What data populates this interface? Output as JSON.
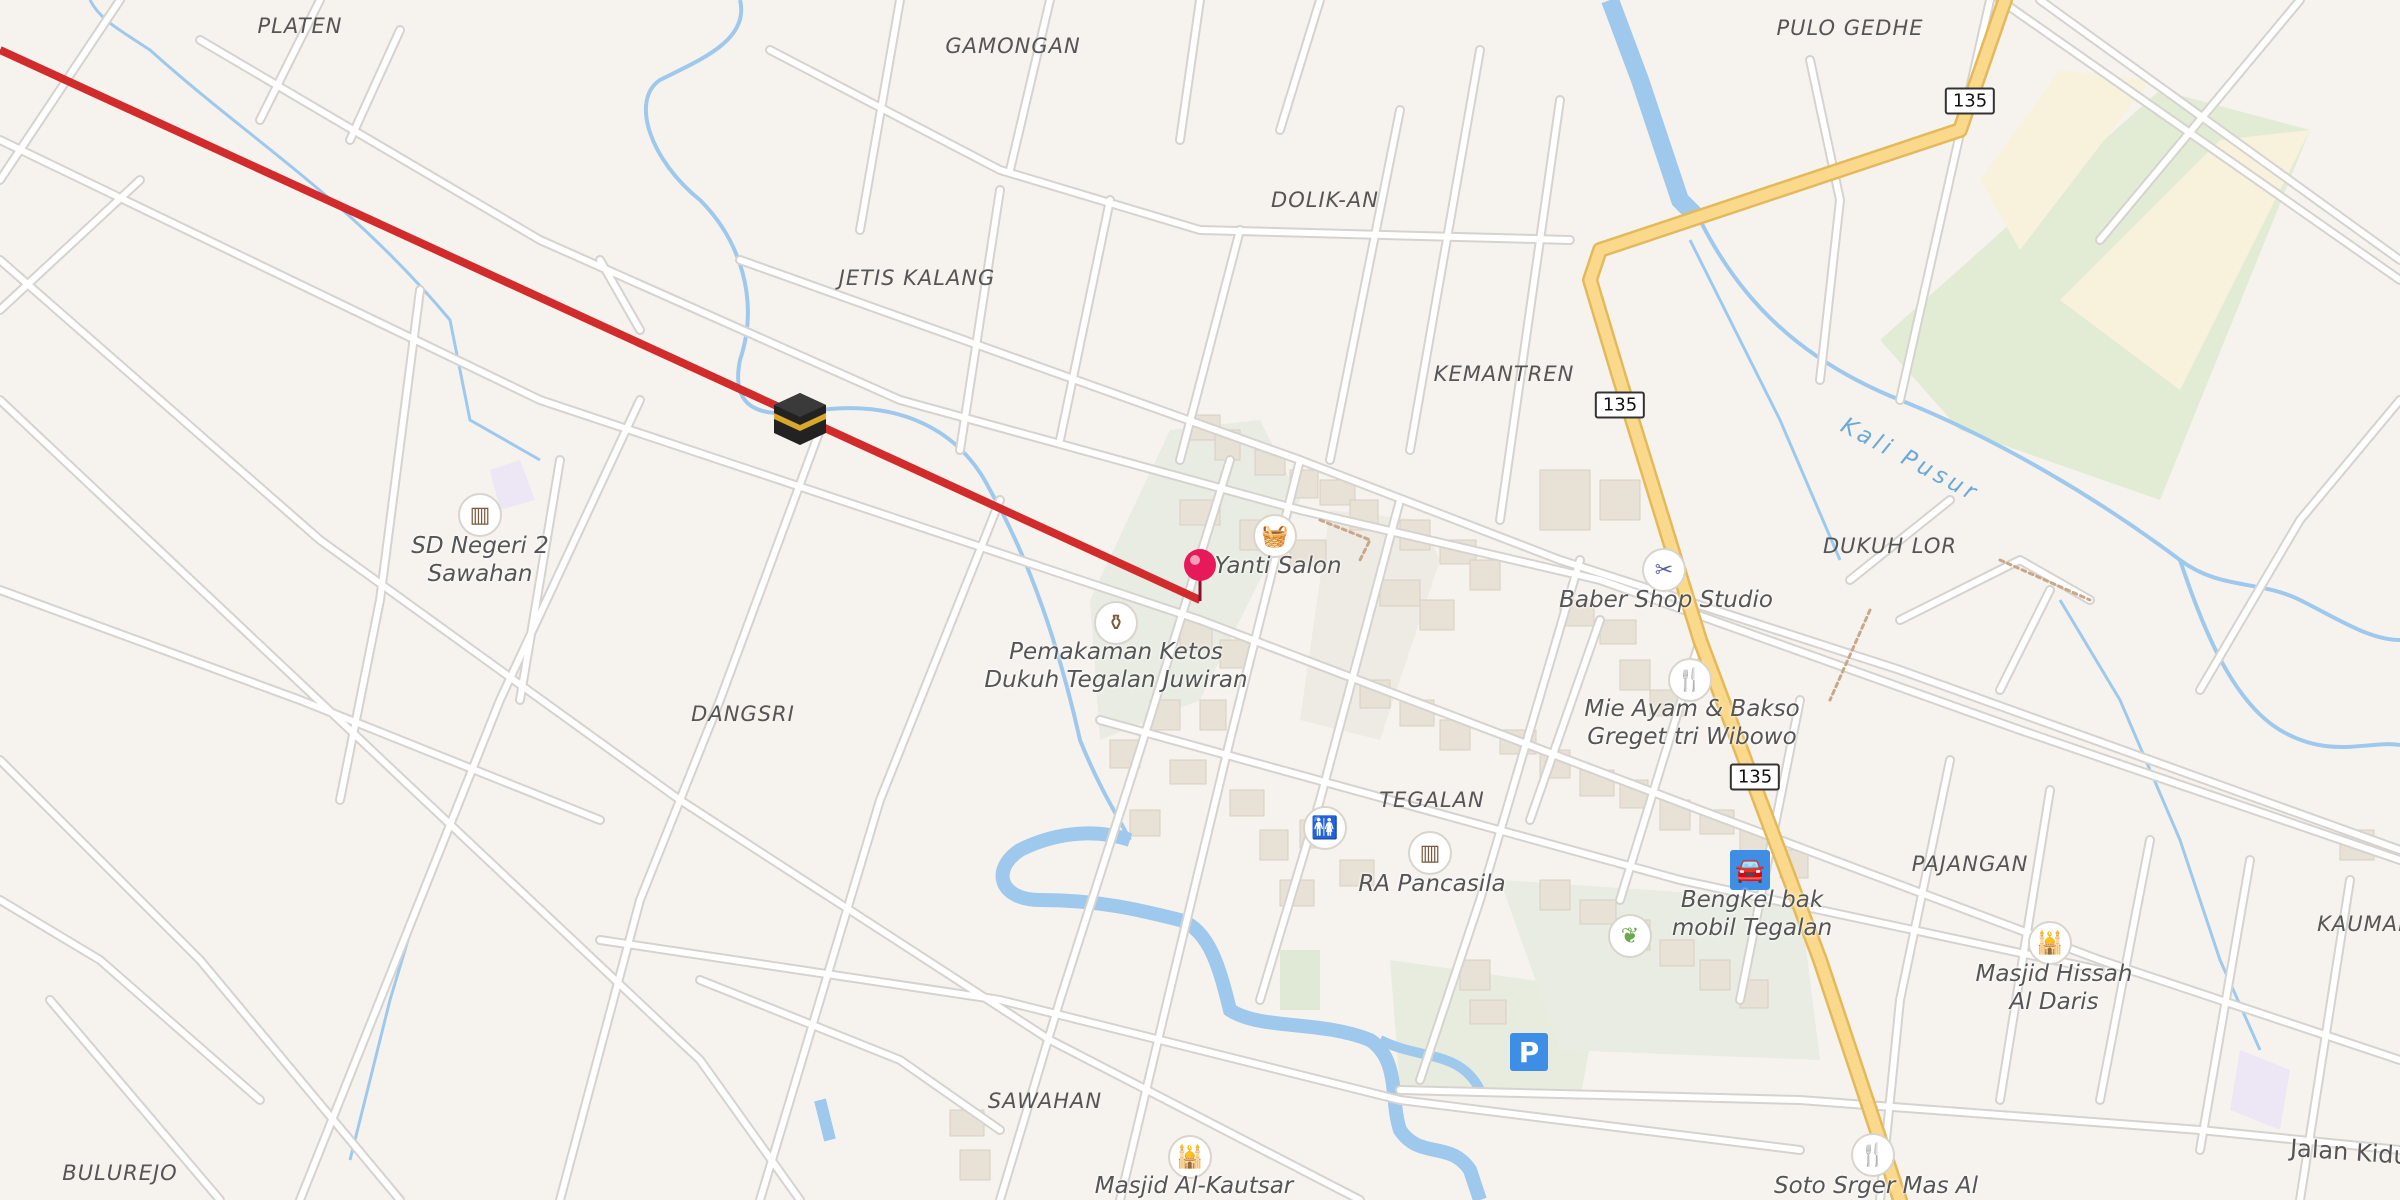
{
  "places": [
    {
      "name": "PLATEN"
    },
    {
      "name": "GAMONGAN"
    },
    {
      "name": "PULO GEDHE"
    },
    {
      "name": "DOLIK-AN"
    },
    {
      "name": "JETIS KALANG"
    },
    {
      "name": "KEMANTREN"
    },
    {
      "name": "DUKUH LOR"
    },
    {
      "name": "DANGSRI"
    },
    {
      "name": "TEGALAN"
    },
    {
      "name": "PAJANGAN"
    },
    {
      "name": "KAUMAN"
    },
    {
      "name": "SAWAHAN"
    },
    {
      "name": "BULUREJO"
    }
  ],
  "pois": [
    {
      "label": "SD Negeri 2\nSawahan",
      "icon_name": "school-icon",
      "glyph": "▥"
    },
    {
      "label": "Yanti Salon",
      "icon_name": "shop-basket-icon",
      "glyph": "🧺"
    },
    {
      "label": "Pemakaman Ketos\nDukuh Tegalan Juwiran",
      "icon_name": "cemetery-icon",
      "glyph": "⚱"
    },
    {
      "label": "Baber Shop Studio",
      "icon_name": "scissors-icon",
      "glyph": "✂"
    },
    {
      "label": "Mie Ayam & Bakso\nGreget tri Wibowo",
      "icon_name": "restaurant-icon",
      "glyph": "🍴"
    },
    {
      "label": "RA Pancasila",
      "icon_name": "school-icon",
      "glyph": "▥"
    },
    {
      "label": "",
      "icon_name": "toilets-icon",
      "glyph": "🚻"
    },
    {
      "label": "Bengkel bak\nmobil Tegalan",
      "icon_name": "car-repair-icon",
      "glyph": "🚘"
    },
    {
      "label": "",
      "icon_name": "garden-center-icon",
      "glyph": "❦"
    },
    {
      "label": "Masjid Hissah\nAl Daris",
      "icon_name": "mosque-icon",
      "glyph": "🕌"
    },
    {
      "label": "Masjid Al-Kautsar",
      "icon_name": "mosque-icon",
      "glyph": "🕌"
    },
    {
      "label": "Soto Srger Mas Al",
      "icon_name": "restaurant-icon",
      "glyph": "🍴"
    }
  ],
  "road_shields": [
    "135",
    "135",
    "135"
  ],
  "parking": {
    "label": "P"
  },
  "river": {
    "name": "Kali Pusur"
  },
  "street": {
    "name": "Jalan Kidu"
  },
  "qibla": {
    "icon_name": "kaaba-icon"
  },
  "marker": {
    "icon_name": "location-pin-icon"
  },
  "colors": {
    "background": "#f6f3ef",
    "road": "#ffffff",
    "road_casing": "#d6d3cf",
    "main_road": "#fbd98c",
    "main_road_casing": "#e3b95a",
    "water": "#9fc9ec",
    "qibla_line": "#d22b2b",
    "pin": "#e8195a",
    "parking": "#3e8ee6"
  }
}
